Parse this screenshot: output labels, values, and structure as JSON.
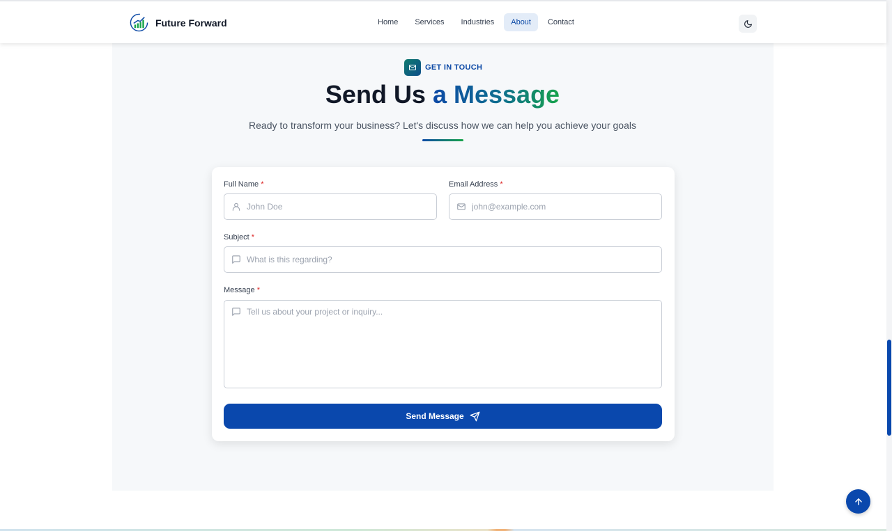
{
  "header": {
    "brand_name": "Future Forward",
    "nav": [
      {
        "label": "Home",
        "active": false
      },
      {
        "label": "Services",
        "active": false
      },
      {
        "label": "Industries",
        "active": false
      },
      {
        "label": "About",
        "active": true
      },
      {
        "label": "Contact",
        "active": false
      }
    ],
    "theme_toggle_icon": "moon-icon"
  },
  "section": {
    "tag_icon": "mail-icon",
    "tag_label": "GET IN TOUCH",
    "title_part1": "Send Us ",
    "title_part2": "a Message",
    "subtitle": "Ready to transform your business? Let's discuss how we can help you achieve your goals"
  },
  "form": {
    "full_name": {
      "label": "Full Name",
      "required_mark": "*",
      "placeholder": "John Doe",
      "icon": "user-icon"
    },
    "email": {
      "label": "Email Address",
      "required_mark": "*",
      "placeholder": "john@example.com",
      "icon": "mail-icon"
    },
    "subject": {
      "label": "Subject",
      "required_mark": "*",
      "placeholder": "What is this regarding?",
      "icon": "message-square-icon"
    },
    "message": {
      "label": "Message",
      "required_mark": "*",
      "placeholder": "Tell us about your project or inquiry...",
      "icon": "message-square-icon"
    },
    "submit_label": "Send Message",
    "submit_icon": "send-icon"
  },
  "floating": {
    "scroll_top_icon": "arrow-up-icon"
  },
  "colors": {
    "primary": "#0a48ad",
    "accent_green": "#16a34a",
    "section_bg": "#f6f8fa",
    "required": "#dc2626"
  }
}
